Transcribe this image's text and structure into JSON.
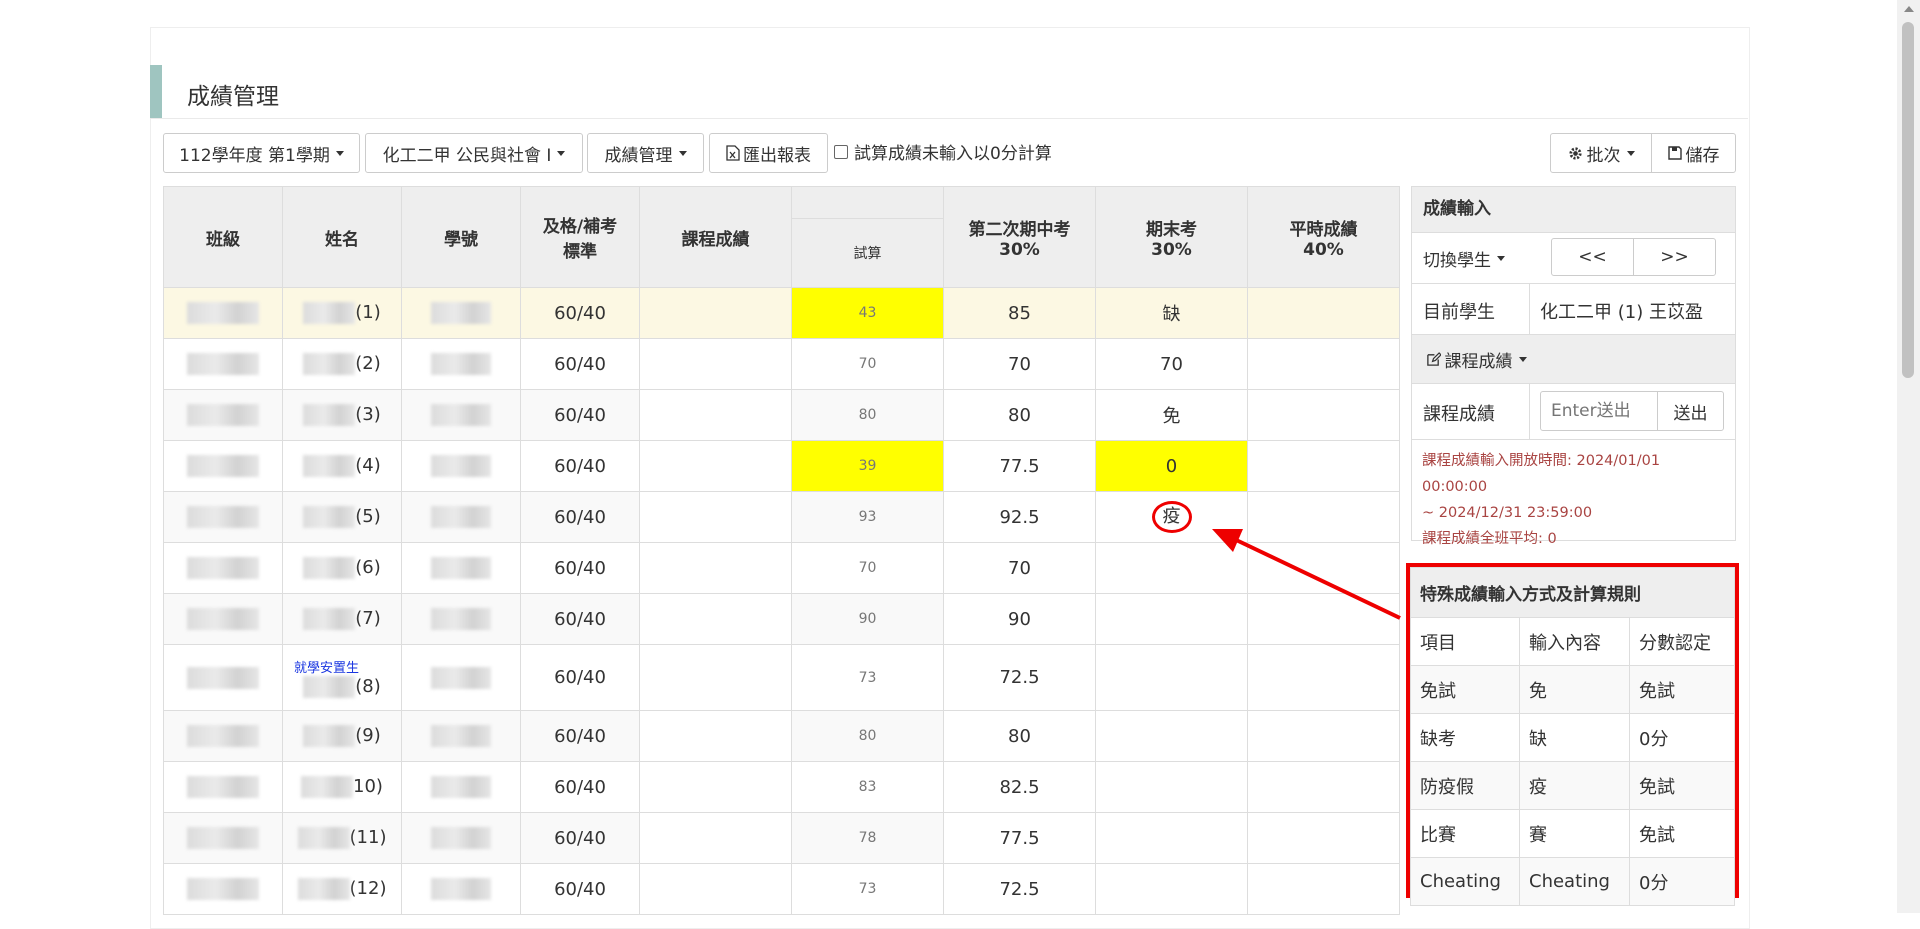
{
  "page_title": "成績管理",
  "toolbar": {
    "semester": "112學年度 第1學期",
    "course": "化工二甲 公民與社會 I",
    "mode": "成績管理",
    "export": "匯出報表",
    "zero_checkbox": "試算成績未輸入以0分計算",
    "batch": "批次",
    "save": "儲存"
  },
  "table": {
    "headers": {
      "class": "班級",
      "name": "姓名",
      "student_id": "學號",
      "pass_std_1": "及格/補考",
      "pass_std_2": "標準",
      "course_grade": "課程成績",
      "calc": "試算",
      "midterm_1": "第二次期中考",
      "midterm_2": "30%",
      "final_1": "期末考",
      "final_2": "30%",
      "regular_1": "平時成績",
      "regular_2": "40%"
    },
    "rows": [
      {
        "seat": "(1)",
        "std": "60/40",
        "calc": "43",
        "mid": "85",
        "final": "缺"
      },
      {
        "seat": "(2)",
        "std": "60/40",
        "calc": "70",
        "mid": "70",
        "final": "70"
      },
      {
        "seat": "(3)",
        "std": "60/40",
        "calc": "80",
        "mid": "80",
        "final": "免"
      },
      {
        "seat": "(4)",
        "std": "60/40",
        "calc": "39",
        "mid": "77.5",
        "final": "0"
      },
      {
        "seat": "(5)",
        "std": "60/40",
        "calc": "93",
        "mid": "92.5",
        "final": "疫"
      },
      {
        "seat": "(6)",
        "std": "60/40",
        "calc": "70",
        "mid": "70",
        "final": ""
      },
      {
        "seat": "(7)",
        "std": "60/40",
        "calc": "90",
        "mid": "90",
        "final": ""
      },
      {
        "seat": "(8)",
        "std": "60/40",
        "calc": "73",
        "mid": "72.5",
        "final": "",
        "tag": "就學安置生"
      },
      {
        "seat": "(9)",
        "std": "60/40",
        "calc": "80",
        "mid": "80",
        "final": ""
      },
      {
        "seat": "10)",
        "std": "60/40",
        "calc": "83",
        "mid": "82.5",
        "final": ""
      },
      {
        "seat": "(11)",
        "std": "60/40",
        "calc": "78",
        "mid": "77.5",
        "final": ""
      },
      {
        "seat": "(12)",
        "std": "60/40",
        "calc": "73",
        "mid": "72.5",
        "final": ""
      }
    ]
  },
  "side": {
    "input_head": "成績輸入",
    "switch_label": "切換學生",
    "prev": "<<",
    "next": ">>",
    "current_label": "目前學生",
    "current_value": "化工二甲 (1) 王苡盈",
    "course_menu": "課程成績",
    "course_label": "課程成績",
    "enter_placeholder": "Enter送出",
    "send": "送出",
    "note1": "課程成績輸入開放時間: 2024/01/01 00:00:00",
    "note2": "~ 2024/12/31 23:59:00",
    "note3": "課程成績全班平均: 0"
  },
  "rules": {
    "title": "特殊成績輸入方式及計算規則",
    "headers": [
      "項目",
      "輸入內容",
      "分數認定"
    ],
    "rows": [
      [
        "免試",
        "免",
        "免試"
      ],
      [
        "缺考",
        "缺",
        "0分"
      ],
      [
        "防疫假",
        "疫",
        "免試"
      ],
      [
        "比賽",
        "賽",
        "免試"
      ],
      [
        "Cheating",
        "Cheating",
        "0分"
      ]
    ]
  },
  "colors": {
    "highlight_yellow": "#ffff00",
    "annotation_red": "#e00000",
    "note_red": "#a94442"
  }
}
